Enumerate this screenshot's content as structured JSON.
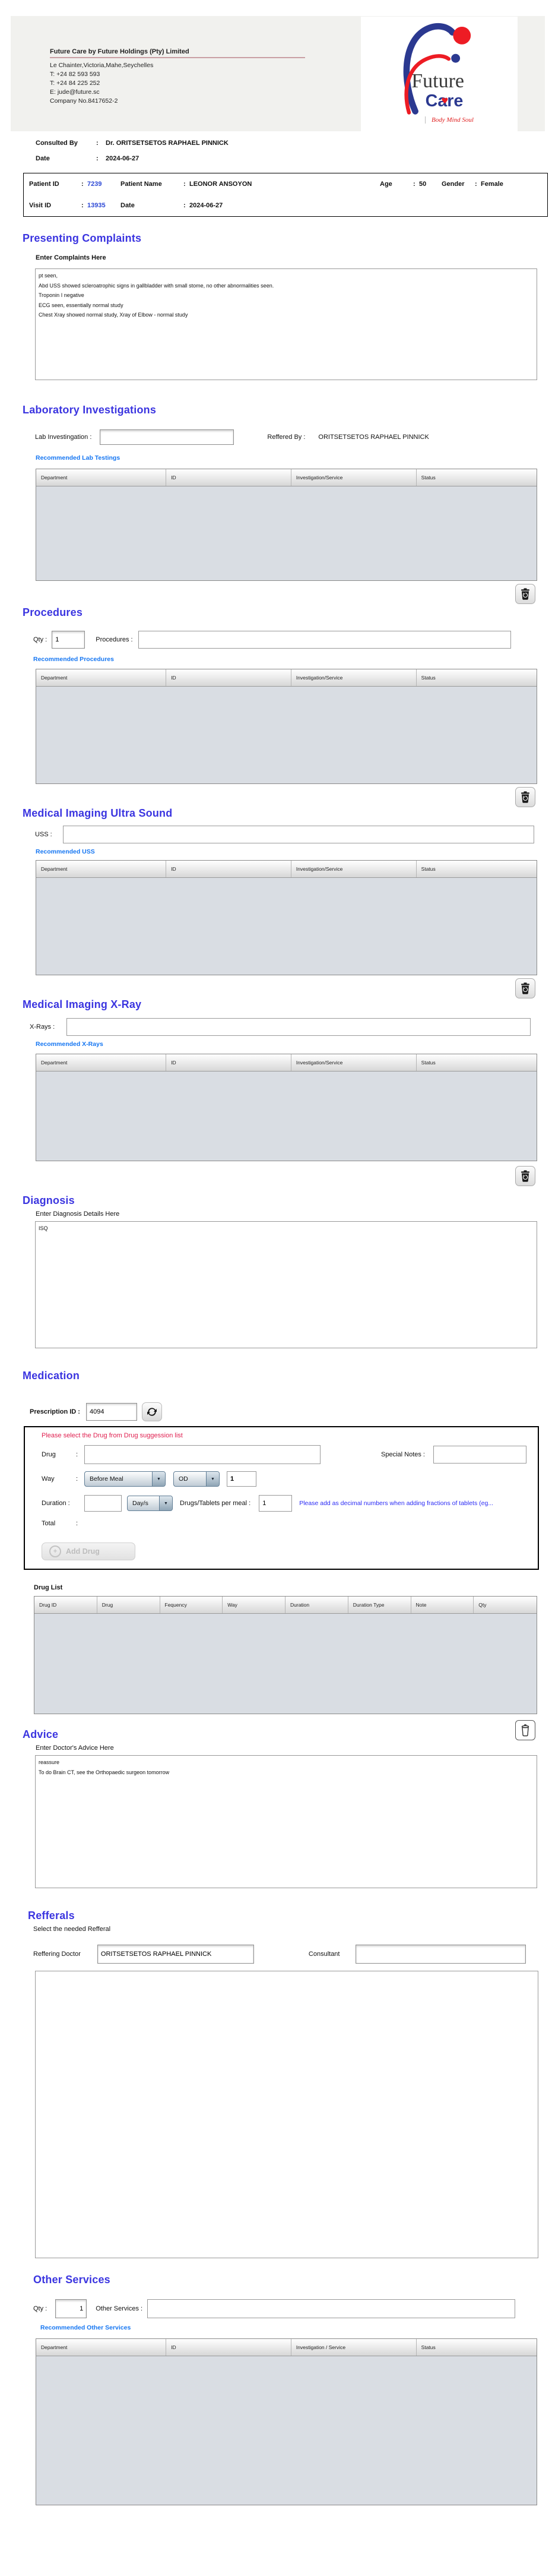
{
  "colors": {
    "heading_blue": "#3b35e0",
    "link_blue": "#1576f2",
    "warning_red": "#e02050",
    "note_blue": "#2a2af5",
    "brand_blue": "#2b3990",
    "brand_red": "#ed1c24",
    "id_blue": "#2d49d6",
    "table_body_gray": "#d9dde3"
  },
  "company": {
    "name_line": "Future Care by Future Holdings (Pty) Limited",
    "address": "Le Chainter,Victoria,Mahe,Seychelles",
    "phone1": "T: +24  82 593 593",
    "phone2": "T: +24  84 225 252",
    "email": "E: jude@future.sc",
    "company_no": "Company No.8417652-2"
  },
  "logo": {
    "word1": "Future",
    "word2": "Care",
    "tagline": "Body Mind Soul"
  },
  "consultation": {
    "consulted_by_label": "Consulted By",
    "colon": ":",
    "consulted_by_value": "Dr.  ORITSETSETOS RAPHAEL PINNICK",
    "date_label": "Date",
    "date_value": "2024-06-27"
  },
  "patient": {
    "patient_id_label": "Patient ID",
    "colon": ":",
    "patient_id": "7239",
    "patient_name_label": "Patient Name",
    "patient_name": "LEONOR ANSOYON",
    "age_label": "Age",
    "age": "50",
    "gender_label": "Gender",
    "gender": "Female",
    "visit_id_label": "Visit ID",
    "visit_id": "13935",
    "visit_date_label": "Date",
    "visit_date": "2024-06-27"
  },
  "presenting_complaints": {
    "title": "Presenting Complaints",
    "label": "Enter Complaints Here",
    "text": "pt seen,\nAbd USS showed scleroatrophic signs in gallbladder with small stome, no other abnormalities seen.\nTroponin I negative\nECG seen, essentially normal study\nChest Xray showed normal study, Xray of Elbow - normal study"
  },
  "laboratory": {
    "title": "Laboratory  Investigations",
    "lab_label": "Lab Investingation :",
    "lab_value": "",
    "referred_label": "Reffered By :",
    "referred_value": "ORITSETSETOS RAPHAEL PINNICK",
    "recommended": "Recommended Lab Testings",
    "table_headers": [
      "Department",
      "ID",
      "Investigation/Service",
      "Status"
    ]
  },
  "procedures": {
    "title": "Procedures",
    "qty_label": "Qty :",
    "qty_value": "1",
    "label": "Procedures :",
    "value": "",
    "recommended": "Recommended Procedures",
    "table_headers": [
      "Department",
      "ID",
      "Investigation/Service",
      "Status"
    ]
  },
  "ultrasound": {
    "title": "Medical Imaging Ultra Sound",
    "label": "USS :",
    "value": "",
    "recommended": "Recommended USS",
    "table_headers": [
      "Department",
      "ID",
      "Investigation/Service",
      "Status"
    ]
  },
  "xray": {
    "title": "Medical Imaging X-Ray",
    "label": "X-Rays :",
    "value": "",
    "recommended": "Recommended X-Rays",
    "table_headers": [
      "Department",
      "ID",
      "Investigation/Service",
      "Status"
    ]
  },
  "diagnosis": {
    "title": "Diagnosis",
    "label": "Enter Diagnosis Details Here",
    "text": "ISQ"
  },
  "medication": {
    "title": "Medication",
    "prescription_label": "Prescription ID :",
    "prescription_id": "4094",
    "warning": "Please select the Drug from Drug suggession list",
    "drug_label": "Drug",
    "colon": ":",
    "drug_value": "",
    "special_notes_label": "Special Notes  :",
    "special_notes_value": "",
    "way_label": "Way",
    "way_meal_selected": "Before Meal",
    "way_freq_selected": "OD",
    "way_qty_value": "1",
    "duration_label": "Duration :",
    "duration_value": "",
    "duration_unit_selected": "Day/s",
    "per_meal_label": "Drugs/Tablets per meal :",
    "per_meal_value": "1",
    "fraction_note": "Please add as decimal numbers when adding fractions of tablets (eg...",
    "total_label": "Total",
    "add_drug_label": "Add Drug",
    "drug_list_label": "Drug List",
    "table_headers": [
      "Drug ID",
      "Drug",
      "Fequency",
      "Way",
      "Duration",
      "Duration Type",
      "Note",
      "Qty"
    ]
  },
  "advice": {
    "title": "Advice",
    "label": "Enter Doctor's Advice Here",
    "text": "reassure\nTo do Brain CT, see the Orthopaedic surgeon tomorrow"
  },
  "refferals": {
    "title": "Refferals",
    "subtitle": "Select the needed Refferal",
    "reffering_doctor_label": "Reffering Doctor",
    "reffering_doctor_value": "ORITSETSETOS RAPHAEL PINNICK",
    "consultant_label": "Consultant",
    "consultant_value": ""
  },
  "other_services": {
    "title": "Other Services",
    "qty_label": "Qty :",
    "qty_value": "1",
    "label": "Other Services :",
    "value": "",
    "recommended": "Recommended Other Services",
    "table_headers": [
      "Department",
      "ID",
      "Investigation / Service",
      "Status"
    ]
  }
}
